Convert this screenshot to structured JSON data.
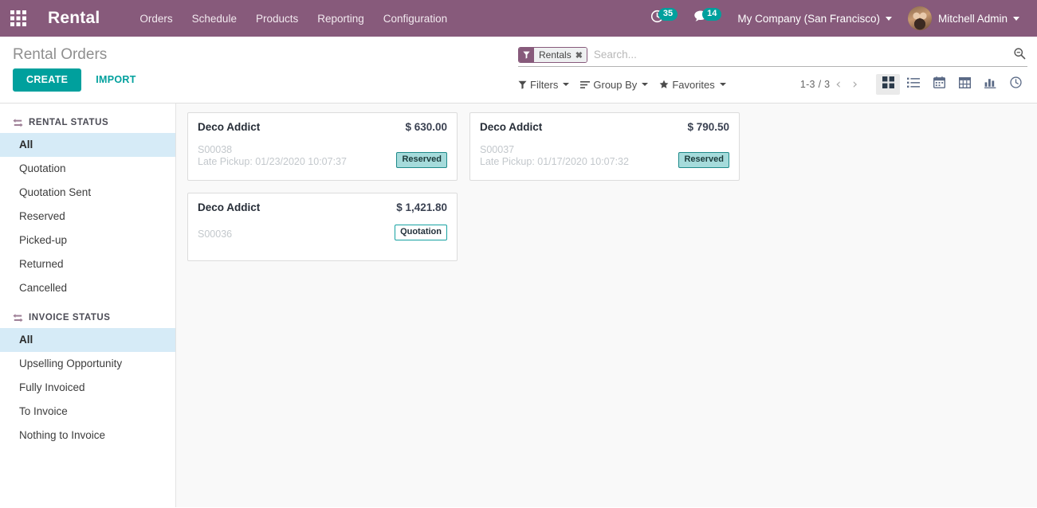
{
  "navbar": {
    "apps_icon": "apps-grid-icon",
    "brand": "Rental",
    "menu": [
      {
        "label": "Orders"
      },
      {
        "label": "Schedule"
      },
      {
        "label": "Products"
      },
      {
        "label": "Reporting"
      },
      {
        "label": "Configuration"
      }
    ],
    "systray": {
      "activity_icon": "clock-activity-icon",
      "activity_count": "35",
      "messaging_icon": "comment-bubble-icon",
      "messaging_count": "14",
      "company": "My Company (San Francisco)",
      "user": "Mitchell Admin",
      "avatar_icon": "user-avatar"
    },
    "brand_color": "#875A7B",
    "badge_color": "#00A09D"
  },
  "control_panel": {
    "breadcrumb": "Rental Orders",
    "create_label": "CREATE",
    "import_label": "IMPORT",
    "accent_color": "#00A09D",
    "search": {
      "facet_label": "Rentals",
      "facet_icon": "filter-funnel-icon",
      "facet_close": "✖",
      "placeholder": "Search...",
      "value": "",
      "magnifier_icon": "search-icon"
    },
    "filters": {
      "filters_label": "Filters",
      "group_by_label": "Group By",
      "favorites_label": "Favorites"
    },
    "pager": {
      "range": "1-3 / 3",
      "previous_icon": "chevron-left-icon",
      "next_icon": "chevron-right-icon"
    },
    "views": [
      {
        "name": "kanban",
        "icon": "kanban-icon",
        "active": true
      },
      {
        "name": "list",
        "icon": "list-icon",
        "active": false
      },
      {
        "name": "calendar",
        "icon": "calendar-icon",
        "active": false
      },
      {
        "name": "pivot",
        "icon": "pivot-table-icon",
        "active": false
      },
      {
        "name": "graph",
        "icon": "bar-chart-icon",
        "active": false
      },
      {
        "name": "activity",
        "icon": "clock-icon",
        "active": false
      }
    ]
  },
  "sidebar": {
    "sections": [
      {
        "title": "RENTAL STATUS",
        "icon": "exchange-arrows-icon",
        "items": [
          {
            "label": "All",
            "active": true
          },
          {
            "label": "Quotation",
            "active": false
          },
          {
            "label": "Quotation Sent",
            "active": false
          },
          {
            "label": "Reserved",
            "active": false
          },
          {
            "label": "Picked-up",
            "active": false
          },
          {
            "label": "Returned",
            "active": false
          },
          {
            "label": "Cancelled",
            "active": false
          }
        ]
      },
      {
        "title": "INVOICE STATUS",
        "icon": "exchange-arrows-icon",
        "items": [
          {
            "label": "All",
            "active": true
          },
          {
            "label": "Upselling Opportunity",
            "active": false
          },
          {
            "label": "Fully Invoiced",
            "active": false
          },
          {
            "label": "To Invoice",
            "active": false
          },
          {
            "label": "Nothing to Invoice",
            "active": false
          }
        ]
      }
    ]
  },
  "kanban": {
    "cards": [
      {
        "partner": "Deco Addict",
        "amount": "$ 630.00",
        "reference": "S00038",
        "late_pickup": "Late Pickup: 01/23/2020 10:07:37",
        "state": "Reserved",
        "state_style": "reserved"
      },
      {
        "partner": "Deco Addict",
        "amount": "$ 790.50",
        "reference": "S00037",
        "late_pickup": "Late Pickup: 01/17/2020 10:07:32",
        "state": "Reserved",
        "state_style": "reserved"
      },
      {
        "partner": "Deco Addict",
        "amount": "$ 1,421.80",
        "reference": "S00036",
        "late_pickup": "",
        "state": "Quotation",
        "state_style": "quotation"
      }
    ]
  }
}
